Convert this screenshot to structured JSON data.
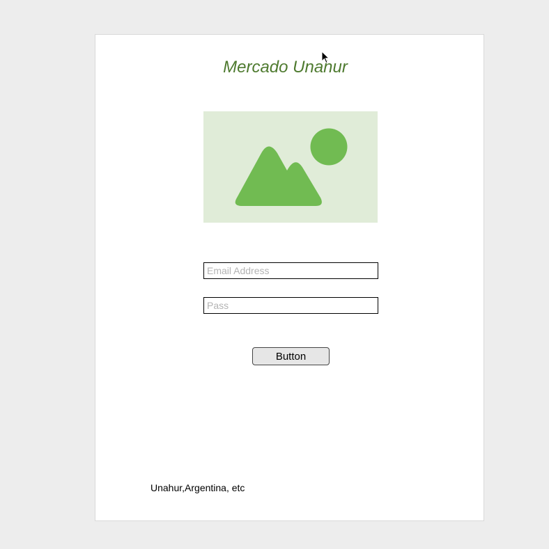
{
  "page": {
    "title": "Mercado Unahur"
  },
  "image": {
    "icon": "image-placeholder-icon",
    "background_color": "#e0ecd8",
    "shape_color": "#71bb52"
  },
  "form": {
    "email_placeholder": "Email Address",
    "email_value": "",
    "pass_placeholder": "Pass",
    "pass_value": "",
    "button_label": "Button"
  },
  "footer": {
    "text": "Unahur,Argentina, etc"
  },
  "colors": {
    "title": "#4e7a2f",
    "page_background": "#ededed",
    "card_background": "#ffffff"
  }
}
